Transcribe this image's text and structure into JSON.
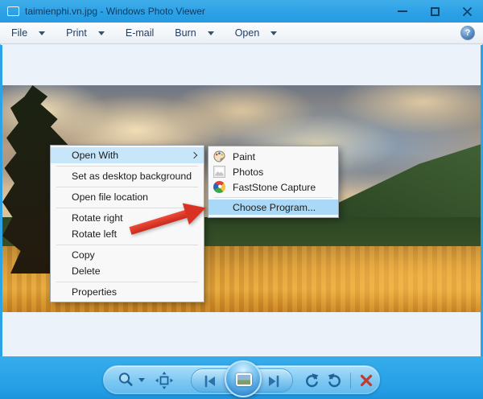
{
  "window": {
    "title": "taimienphi.vn.jpg - Windows Photo Viewer"
  },
  "menubar": {
    "items": [
      {
        "label": "File",
        "has_dropdown": true
      },
      {
        "label": "Print",
        "has_dropdown": true
      },
      {
        "label": "E-mail",
        "has_dropdown": false
      },
      {
        "label": "Burn",
        "has_dropdown": true
      },
      {
        "label": "Open",
        "has_dropdown": true
      }
    ],
    "help_label": "?"
  },
  "context_menu": {
    "items": [
      "Open With",
      "Set as desktop background",
      "Open file location",
      "Rotate right",
      "Rotate left",
      "Copy",
      "Delete",
      "Properties"
    ],
    "highlighted_item": "Open With"
  },
  "open_with_submenu": {
    "items": [
      {
        "label": "Paint",
        "icon": "paint-icon"
      },
      {
        "label": "Photos",
        "icon": "photos-icon"
      },
      {
        "label": "FastStone Capture",
        "icon": "faststone-icon"
      },
      {
        "label": "Choose Program...",
        "icon": ""
      }
    ],
    "highlighted_item": "Choose Program..."
  },
  "toolbar": {
    "buttons": [
      "zoom",
      "actual-size",
      "previous",
      "play-slideshow",
      "next",
      "rotate-counterclockwise",
      "rotate-clockwise",
      "delete"
    ]
  },
  "annotation": {
    "shape": "red-arrow",
    "points_to": "Choose Program..."
  },
  "colors": {
    "titlebar_blue": "#2CA2E7",
    "bottombar_blue": "#27A3E8",
    "toolbar_pill_blue": "#7CC8F2",
    "menu_highlight": "#C7E6F9",
    "submenu_highlight": "#A9D9F6",
    "arrow_red": "#D93225"
  }
}
